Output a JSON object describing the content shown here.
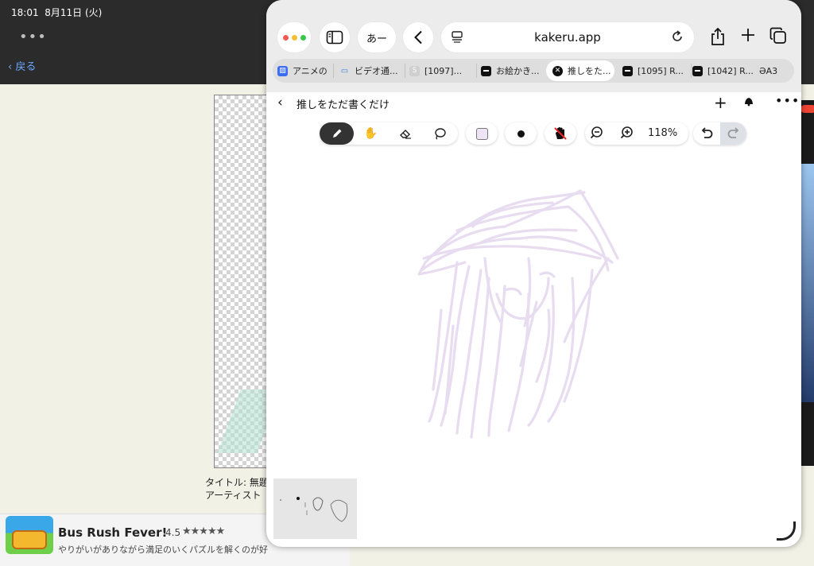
{
  "status_bar": {
    "time": "18:01",
    "date": "8月11日 (火)"
  },
  "background_app": {
    "more_dots": "•••",
    "back_label": "戻る",
    "info_title": "タイトル: 無題",
    "info_artist": "アーティスト"
  },
  "ad": {
    "title": "Bus Rush Fever!",
    "rating": "4.5",
    "stars": "★★★★★",
    "description": "やりがいがありながら満足のいくパズルを解くのが好"
  },
  "safari": {
    "ime_label": "あー",
    "url": "kakeru.app",
    "tabs": [
      {
        "label": "アニメの",
        "favicon_color": "#3b6cf4",
        "icon": "anime-favicon-icon"
      },
      {
        "label": "ビデオ通...",
        "favicon_color": "#ffffff",
        "icon": "video-favicon-icon"
      },
      {
        "label": "[1097]...",
        "favicon_color": "#cfcfcf",
        "icon": "s-favicon-icon"
      },
      {
        "label": "お絵かき...",
        "favicon_color": "#111111",
        "icon": "drawing-favicon-icon"
      },
      {
        "label": "推しをた...",
        "favicon_color": "#111111",
        "icon": "close-icon"
      },
      {
        "label": "[1095] R...",
        "favicon_color": "#111111",
        "icon": "page-favicon-icon"
      },
      {
        "label": "[1042] R...",
        "favicon_color": "#111111",
        "icon": "page-favicon-icon"
      },
      {
        "label": "ƏA3",
        "favicon_color": "#dedede",
        "icon": "none"
      }
    ]
  },
  "page": {
    "title": "推しをただ書くだけ",
    "zoom_level": "118%",
    "current_color": "#efe4f6",
    "stroke_color": "#e8dcf0",
    "active_tool": "pen"
  }
}
